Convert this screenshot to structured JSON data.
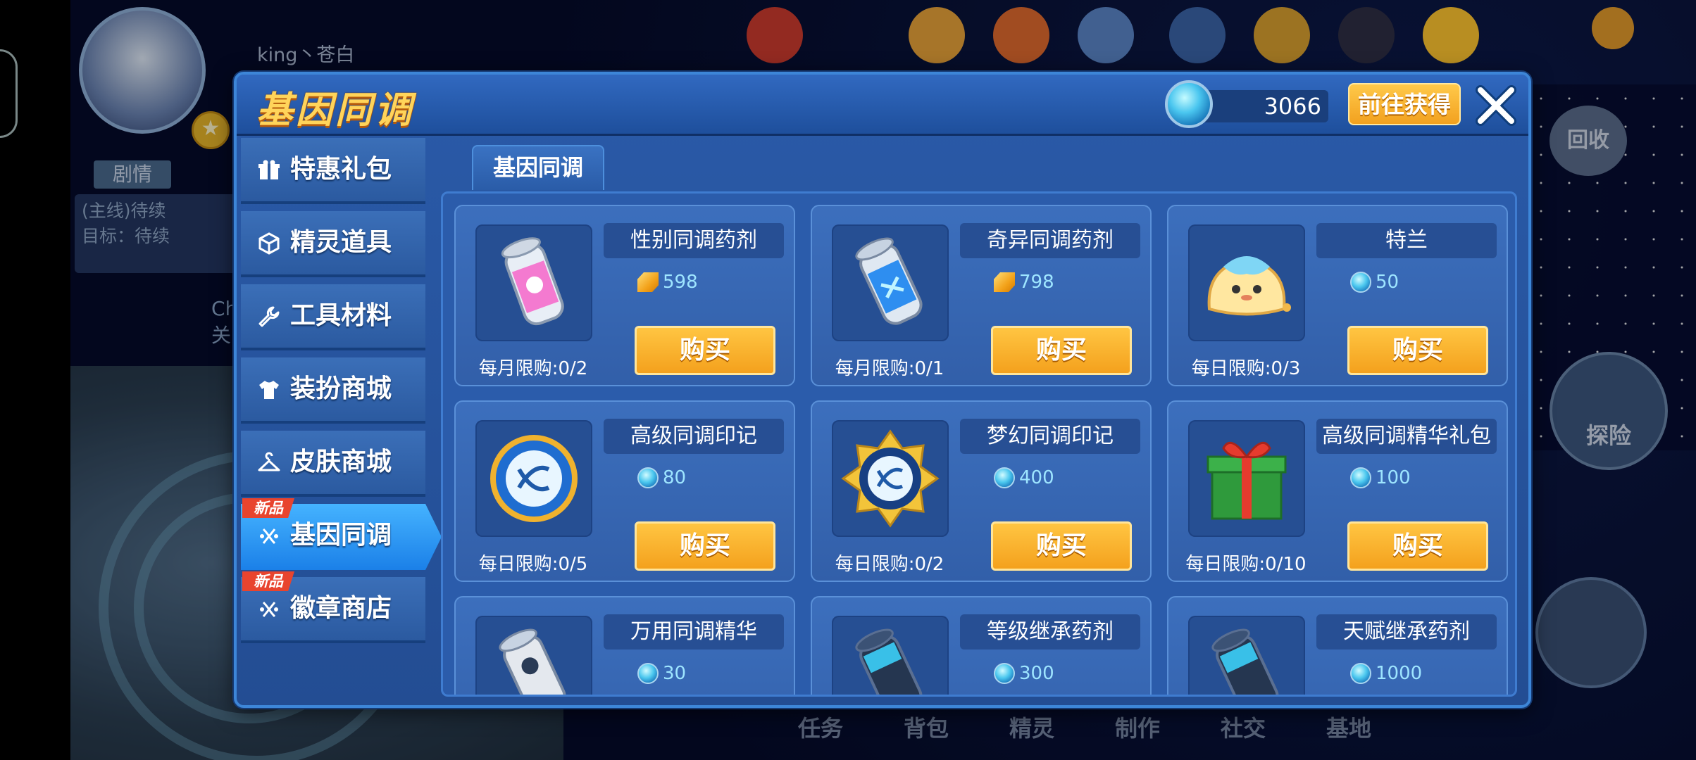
{
  "player": {
    "name": "king丶苍白"
  },
  "story": {
    "tag": "剧情",
    "quest_line1": "(主线)待续",
    "quest_line2": "目标：待续",
    "partial1": "Ch",
    "partial2": "关"
  },
  "bottom_menu": [
    "任务",
    "背包",
    "精灵",
    "制作",
    "社交",
    "基地"
  ],
  "right_ui": {
    "explore": "探险",
    "recycle": "回收"
  },
  "dialog": {
    "title": "基因同调",
    "currency_value": "3066",
    "get_button": "前往获得",
    "tab": "基因同调"
  },
  "sidebar": [
    {
      "label": "特惠礼包",
      "icon": "gift-icon",
      "new": false,
      "active": false
    },
    {
      "label": "精灵道具",
      "icon": "cube-icon",
      "new": false,
      "active": false
    },
    {
      "label": "工具材料",
      "icon": "wrench-icon",
      "new": false,
      "active": false
    },
    {
      "label": "装扮商城",
      "icon": "shirt-icon",
      "new": false,
      "active": false
    },
    {
      "label": "皮肤商城",
      "icon": "hanger-icon",
      "new": false,
      "active": false
    },
    {
      "label": "基因同调",
      "icon": "gene-icon",
      "new": true,
      "active": true
    },
    {
      "label": "徽章商店",
      "icon": "gene-icon",
      "new": true,
      "active": false
    }
  ],
  "new_badge": "新品",
  "buy_label": "购买",
  "items": [
    {
      "name": "性别同调药剂",
      "currency": "gem",
      "price": "598",
      "limit": "每月限购:0/2",
      "icon": "pink-potion-icon"
    },
    {
      "name": "奇异同调药剂",
      "currency": "gem",
      "price": "798",
      "limit": "每月限购:0/1",
      "icon": "blue-potion-icon"
    },
    {
      "name": "特兰",
      "currency": "orb",
      "price": "50",
      "limit": "每日限购:0/3",
      "icon": "slime-pet-icon"
    },
    {
      "name": "高级同调印记",
      "currency": "orb",
      "price": "80",
      "limit": "每日限购:0/5",
      "icon": "gene-seal-icon"
    },
    {
      "name": "梦幻同调印记",
      "currency": "orb",
      "price": "400",
      "limit": "每日限购:0/2",
      "icon": "gold-gene-seal-icon"
    },
    {
      "name": "高级同调精华礼包",
      "currency": "orb",
      "price": "100",
      "limit": "每日限购:0/10",
      "icon": "gift-box-icon"
    },
    {
      "name": "万用同调精华",
      "currency": "orb",
      "price": "30",
      "limit": "",
      "icon": "silver-potion-icon"
    },
    {
      "name": "等级继承药剂",
      "currency": "orb",
      "price": "300",
      "limit": "",
      "icon": "dark-potion-icon"
    },
    {
      "name": "天赋继承药剂",
      "currency": "orb",
      "price": "1000",
      "limit": "",
      "icon": "dark-potion-icon"
    }
  ]
}
